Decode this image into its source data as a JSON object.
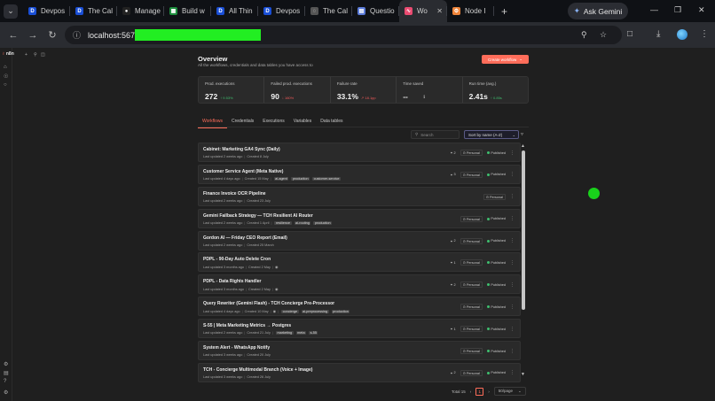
{
  "browser": {
    "tabs": [
      {
        "label": "Devpos",
        "favicon": "D"
      },
      {
        "label": "The Cal",
        "favicon": "D"
      },
      {
        "label": "Manage",
        "favicon": "github-icon"
      },
      {
        "label": "Build w",
        "favicon": "sheets-icon"
      },
      {
        "label": "All Thin",
        "favicon": "D"
      },
      {
        "label": "Devpos",
        "favicon": "D"
      },
      {
        "label": "The Cal",
        "favicon": "globe-icon"
      },
      {
        "label": "Questio",
        "favicon": "doc-icon"
      },
      {
        "label": "Wo",
        "favicon": "n8n-icon",
        "active": true
      },
      {
        "label": "Node I",
        "favicon": "node-icon"
      }
    ],
    "ask_gemini": "Ask Gemini",
    "url": "localhost:567",
    "accent": "#ff6d5a"
  },
  "app": {
    "logo_text": "n8n",
    "header": {
      "title": "Overview",
      "subtitle": "All the workflows, credentials and data tables you have access to",
      "create_label": "Create workflow"
    },
    "stats": [
      {
        "label": "Prod. executions",
        "value": "272",
        "delta": "↑ 9.53%",
        "trend": "up"
      },
      {
        "label": "Failed prod. executions",
        "value": "90",
        "delta": "↓ 160%",
        "trend": "down"
      },
      {
        "label": "Failure rate",
        "value": "33.1%",
        "delta": "↗ 18.1pp",
        "trend": "down"
      },
      {
        "label": "Time saved",
        "value": "--",
        "delta": "",
        "trend": ""
      },
      {
        "label": "Run time (avg.)",
        "value": "2.41s",
        "delta": "↑ 0.85s",
        "trend": "up"
      }
    ],
    "tabs": [
      "Workflows",
      "Credentials",
      "Executions",
      "Variables",
      "Data tables"
    ],
    "search_placeholder": "Search",
    "sort_value": "Sort by name (A-Z)",
    "workflows": [
      {
        "name": "Cabinet: Marketing GA4 Sync (Daily)",
        "updated": "Last updated 2 weeks ago",
        "created": "Created 8 July",
        "tags": [],
        "shares": "2",
        "owner": "Personal",
        "status": "Published"
      },
      {
        "name": "Customer Service Agent (Meta Native)",
        "updated": "Last updated 4 days ago",
        "created": "Created 15 May",
        "tags": [
          "ai-agent",
          "production",
          "customer-service"
        ],
        "shares": "3",
        "owner": "Personal",
        "status": "Published"
      },
      {
        "name": "Finance Invoice OCR Pipeline",
        "updated": "Last updated 2 weeks ago",
        "created": "Created 23 July",
        "tags": [],
        "shares": "",
        "owner": "Personal",
        "status": ""
      },
      {
        "name": "Gemini Failback Strategy — TCH Resilient AI Router",
        "updated": "Last updated 2 weeks ago",
        "created": "Created 1 April",
        "tags": [
          "resilience",
          "ai-routing",
          "production"
        ],
        "shares": "",
        "owner": "Personal",
        "status": "Published"
      },
      {
        "name": "Gordon AI — Friday CEO Report (Email)",
        "updated": "Last updated 2 weeks ago",
        "created": "Created 25 March",
        "tags": [],
        "shares": "2",
        "owner": "Personal",
        "status": "Published"
      },
      {
        "name": "PDPL - 90-Day Auto Delete Cron",
        "updated": "Last updated 3 months ago",
        "created": "Created 2 May",
        "tags": [],
        "folder": true,
        "shares": "1",
        "owner": "Personal",
        "status": "Published"
      },
      {
        "name": "PDPL - Data Rights Handler",
        "updated": "Last updated 3 months ago",
        "created": "Created 2 May",
        "tags": [],
        "folder": true,
        "shares": "2",
        "owner": "Personal",
        "status": "Published"
      },
      {
        "name": "Query Rewriter (Gemini Flash) - TCH Concierge Pre-Processor",
        "updated": "Last updated 4 days ago",
        "created": "Created 10 May",
        "tags": [
          "concierge",
          "ai-preprocessing",
          "production"
        ],
        "folder": true,
        "shares": "",
        "owner": "Personal",
        "status": "Published"
      },
      {
        "name": "S-55 | Meta Marketing Metrics → Postgres",
        "updated": "Last updated 2 weeks ago",
        "created": "Created 21 July",
        "tags": [
          "marketing",
          "meta",
          "s-55"
        ],
        "shares": "1",
        "owner": "Personal",
        "status": "Published"
      },
      {
        "name": "System Alert - WhatsApp Notify",
        "updated": "Last updated 3 weeks ago",
        "created": "Created 20 July",
        "tags": [],
        "shares": "",
        "owner": "Personal",
        "status": "Published"
      },
      {
        "name": "TCH - Concierge Multimodal Branch (Voice + Image)",
        "updated": "Last updated 3 weeks ago",
        "created": "Created 26 July",
        "tags": [],
        "shares": "2",
        "owner": "Personal",
        "status": "Published"
      }
    ],
    "pagination": {
      "total": "Total 15",
      "page": "1",
      "page_size": "50/page"
    }
  }
}
